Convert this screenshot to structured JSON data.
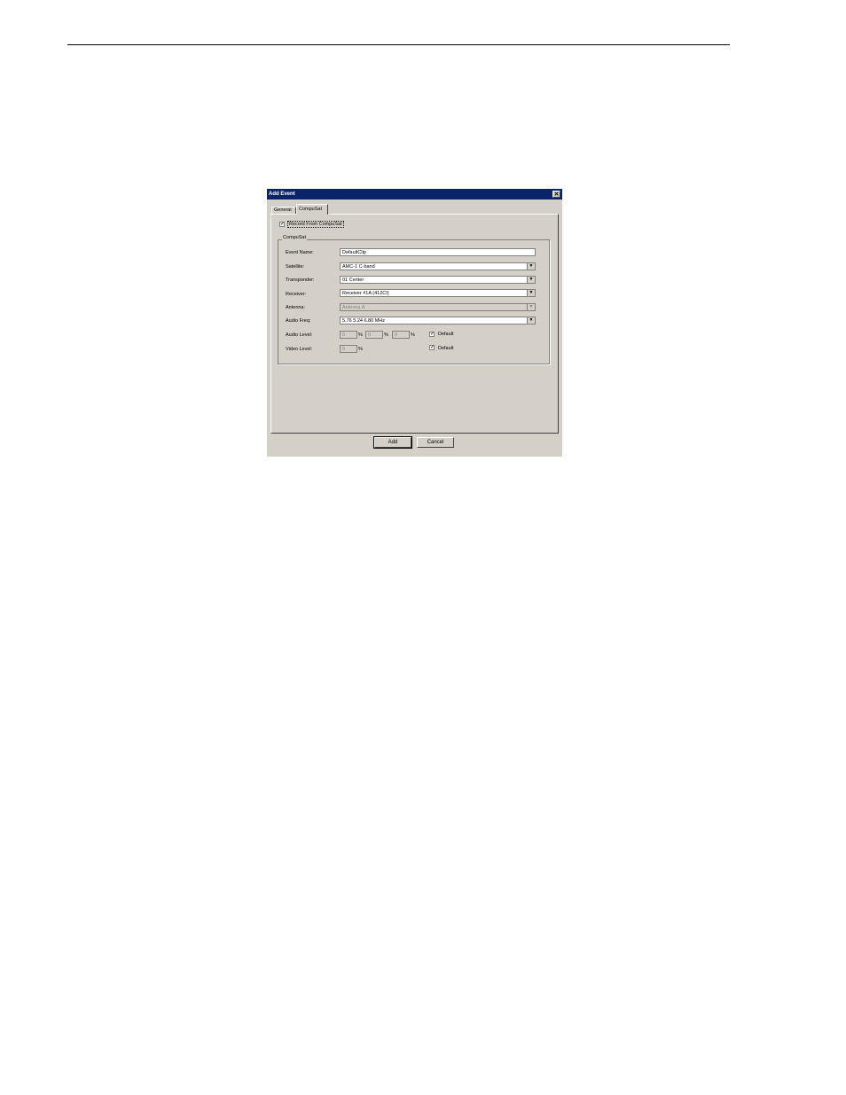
{
  "dialog": {
    "title": "Add Event",
    "close_glyph": "✕",
    "tabs": [
      {
        "label": "General",
        "selected": false
      },
      {
        "label": "CompuSat",
        "selected": true
      }
    ],
    "record": {
      "checked": true,
      "check_glyph": "✓",
      "label": "Record From CompuSat"
    },
    "group_label": "CompuSat",
    "fields": {
      "event_name": {
        "label": "Event Name:",
        "value": "DefaultClip"
      },
      "satellite": {
        "label": "Satellite:",
        "value": "AMC-1  C-band"
      },
      "transponder": {
        "label": "Transponder:",
        "value": "01 Center"
      },
      "receiver": {
        "label": "Receiver:",
        "value": "Receiver #1A (412CI)"
      },
      "antenna": {
        "label": "Antenna:",
        "value": "Antenna A",
        "disabled": true
      },
      "audio_freq": {
        "label": "Audio Freq:",
        "value": "5.76 5.24 6.80 MHz"
      },
      "audio_level": {
        "label": "Audio Level:",
        "values": [
          "0",
          "0",
          "0"
        ],
        "unit": "%",
        "default_checked": true,
        "default_label": "Default"
      },
      "video_level": {
        "label": "Video Level:",
        "value": "0",
        "unit": "%",
        "default_checked": true,
        "default_label": "Default"
      }
    },
    "dropdown_glyph": "▼",
    "buttons": {
      "add": "Add",
      "cancel": "Cancel"
    }
  }
}
